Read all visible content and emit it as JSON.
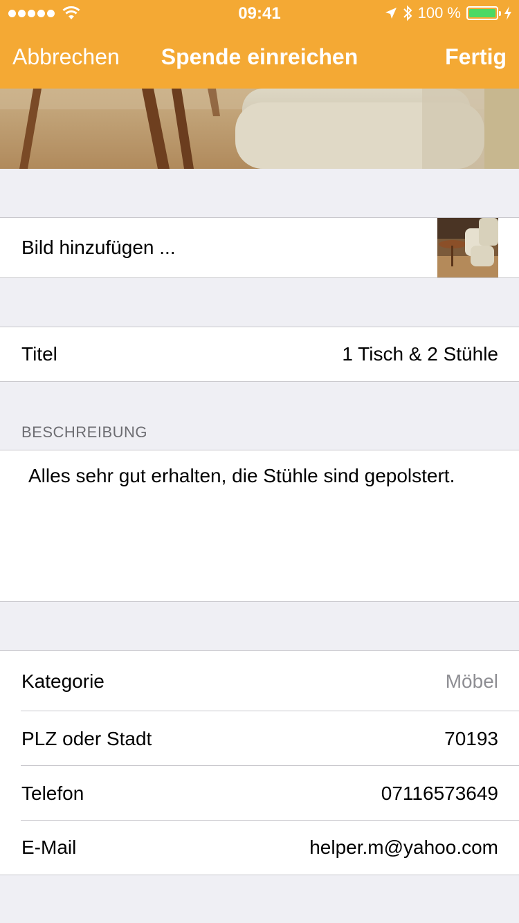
{
  "status_bar": {
    "time": "09:41",
    "battery_text": "100 %",
    "battery_color": "#4cd964"
  },
  "nav": {
    "cancel_label": "Abbrechen",
    "title": "Spende einreichen",
    "done_label": "Fertig",
    "bar_color": "#f4a934"
  },
  "image_cell": {
    "label": "Bild hinzufügen ..."
  },
  "title_cell": {
    "label": "Titel",
    "value": "1 Tisch & 2 Stühle"
  },
  "description": {
    "header": "BESCHREIBUNG",
    "text": "Alles sehr gut erhalten, die Stühle sind gepolstert."
  },
  "details": [
    {
      "label": "Kategorie",
      "value": "Möbel"
    },
    {
      "label": "PLZ oder Stadt",
      "value": "70193"
    },
    {
      "label": "Telefon",
      "value": "07116573649"
    },
    {
      "label": "E-Mail",
      "value": "helper.m@yahoo.com"
    }
  ]
}
